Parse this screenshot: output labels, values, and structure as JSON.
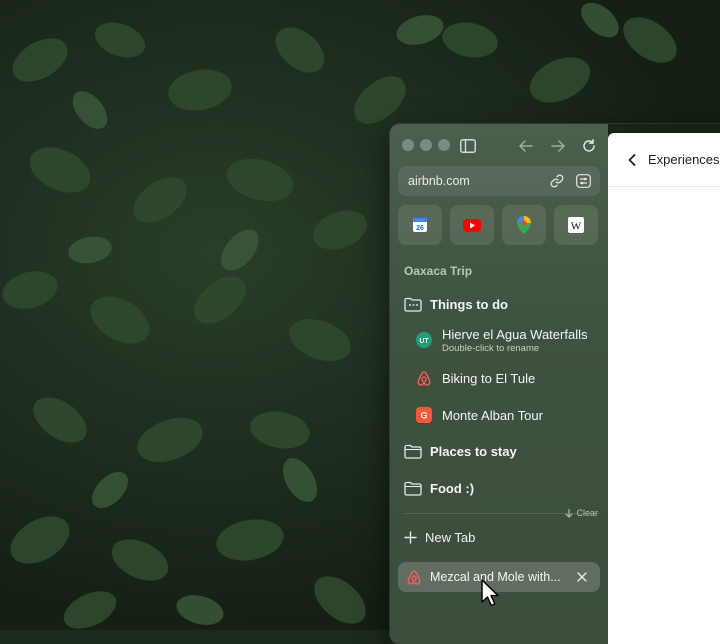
{
  "browser": {
    "url": "airbnb.com",
    "pinned": [
      {
        "icon": "calendar-icon"
      },
      {
        "icon": "youtube-icon"
      },
      {
        "icon": "maps-icon"
      },
      {
        "icon": "wikipedia-icon"
      }
    ],
    "section_title": "Oaxaca Trip",
    "folders": [
      {
        "label": "Things to do",
        "tabs": [
          {
            "label": "Hierve el Agua Waterfalls",
            "hint": "Double-click to rename",
            "icon": "ut-icon"
          },
          {
            "label": "Biking to El Tule",
            "icon": "airbnb-icon"
          },
          {
            "label": "Monte Alban Tour",
            "icon": "getyourguide-icon"
          }
        ]
      },
      {
        "label": "Places to stay"
      },
      {
        "label": "Food :)"
      }
    ],
    "clear_label": "Clear",
    "new_tab_label": "New Tab",
    "active_tab": {
      "label": "Mezcal and Mole with...",
      "icon": "airbnb-icon"
    }
  },
  "content": {
    "header_label": "Experiences"
  },
  "colors": {
    "sidebar": "#435543",
    "airbnb": "#ff5a5f",
    "getyourguide": "#ff5533",
    "youtube": "#ff0000"
  }
}
